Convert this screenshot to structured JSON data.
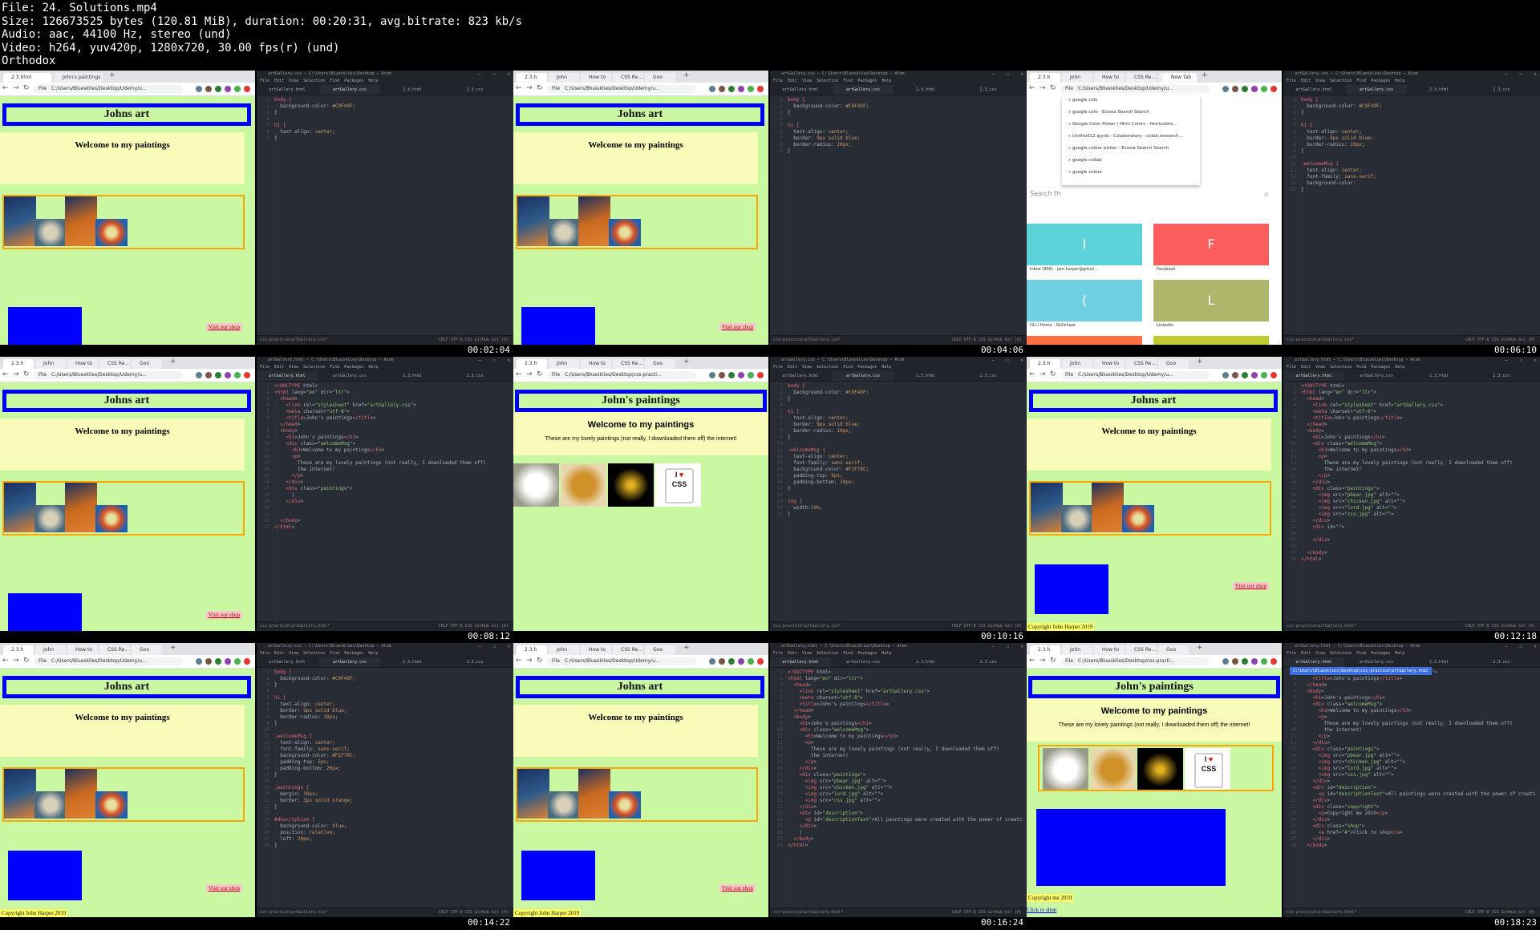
{
  "header": {
    "lines": [
      "File: 24. Solutions.mp4",
      "Size: 126673525 bytes (120.81 MiB), duration: 00:20:31, avg.bitrate: 823 kb/s",
      "Audio: aac, 44100 Hz, stereo (und)",
      "Video: h264, yuv420p, 1280x720, 30.00 fps(r) (und)",
      "Orthodox"
    ]
  },
  "timestamps": [
    "00:02:04",
    "00:04:06",
    "00:06:10",
    "00:08:12",
    "00:10:16",
    "00:12:18",
    "00:14:22",
    "00:16:24",
    "00:18:23"
  ],
  "browser": {
    "url": "C:/Users/Bluesklies/Desktop/Udemy/u...",
    "url2": "C:/Users/Bluesklies/Desktop/css-practi...",
    "url_label": "File",
    "tabs_a": [
      "2.3.html",
      "John's paintings"
    ],
    "tabs_b": [
      "2.3.h",
      "John",
      "How to",
      "CSS Re...",
      "Goo"
    ],
    "site_title_1": "Johns art",
    "site_title_2": "John's paintings",
    "welcome": "Welcome to my paintings",
    "subtitle": "These are my lovely paintings (not really, I downloaded them off) the internet!",
    "shop_link": "Visit our shop",
    "click_shop": "Click to shop",
    "copyright_1": "Copyright John Harper 2019",
    "copyright_2": "Copyright me 2019",
    "description": "All paintings were created with the power of creativity",
    "search_placeholder": "Search th",
    "new_tab": "New Tab",
    "suggestions": [
      "google colo",
      "google colo - Ecosia Search Search",
      "Google Color Picker | Html Colors - htmlcolors...",
      "Untitled12.ipynb - Colaboratory - colab.research...",
      "google colour picker - Ecosia Search Search",
      "google collab",
      "google colors"
    ],
    "tiles": [
      {
        "letter": "I",
        "color": "#5cd3d8",
        "label": "Inbox (996) - jam.harper@gmail..."
      },
      {
        "letter": "F",
        "color": "#fb5d5d",
        "label": "Facebook"
      },
      {
        "letter": "(",
        "color": "#6fd0e3",
        "label": "(9+) Home - Skillshare"
      },
      {
        "letter": "L",
        "color": "#b0b56c",
        "label": "LinkedIn"
      }
    ]
  },
  "atom": {
    "title_css": "artGallery.css — C:\\Users\\Bluesklies\\Desktop — Atom",
    "title_html": "artGallery.html — C:\\Users\\Bluesklies\\Desktop — Atom",
    "menu": "File Edit View Selection Find Packages Help",
    "tabs": [
      "artGallery.html",
      "artGallery.css",
      "2.3.html",
      "2.3.css"
    ],
    "status_css": "css-practice\\artGallery.css*",
    "status_html": "css-practice\\artGallery.html*",
    "status_right": "CRLF  UTF-8  CSS  GitHub  Git (0)",
    "tooltip": "C:\\Users\\Bluesklies\\Desktop\\css-practice\\artGallery.html",
    "css_short": [
      "body {",
      "  background-color: #C9F49F;",
      "}",
      "",
      "h1 {",
      "  text-align: center;",
      "}"
    ],
    "css_border": [
      "body {",
      "  background-color: #C9F49F;",
      "}",
      "",
      "h1 {",
      "  text-align: center;",
      "  border: 9px solid blue;",
      "  border-radius: 10px;",
      "}"
    ],
    "css_welcome": [
      "body {",
      "  background-color: #C9F49F;",
      "}",
      "",
      "h1 {",
      "  text-align: center;",
      "  border: 9px solid blue;",
      "  border-radius: 10px;",
      "}",
      "",
      ".welcomeMsg {",
      "  text-align: center;",
      "  font-family: sans-serif;",
      "  background-color:",
      "}"
    ],
    "css_img": [
      "body {",
      "  background-color: #C9F49F;",
      "}",
      "",
      "h1 {",
      "  text-align: center;",
      "  border: 9px solid blue;",
      "  border-radius: 10px;",
      "}",
      "",
      ".welcomeMsg {",
      "  text-align: center;",
      "  font-family: sans-serif;",
      "  background-color: #F1F78C;",
      "  padding-top: 5px;",
      "  padding-bottom: 20px;",
      "}",
      "",
      "img {",
      "  width:10%;",
      "}"
    ],
    "css_desc": [
      "body {",
      "  background-color: #C9F49F;",
      "}",
      "",
      "h1 {",
      "  text-align: center;",
      "  border: 9px solid blue;",
      "  border-radius: 10px;",
      "}",
      "",
      ".welcomeMsg {",
      "  text-align: center;",
      "  font-family: sans-serif;",
      "  background-color: #F1F78C;",
      "  padding-top: 5px;",
      "  padding-bottom: 20px;",
      "}",
      "",
      ".paintings {",
      "  margin: 30px;",
      "  border: 3px solid orange;",
      "}",
      "",
      "#description {",
      "  background-color: blue;",
      "  position: relative;",
      "  left: 20px;",
      "}"
    ],
    "html_a": [
      "<!DOCTYPE html>",
      "<html lang=\"en\" dir=\"ltr\">",
      "  <head>",
      "    <link rel=\"stylesheet\" href=\"artGallery.css\">",
      "    <meta charset=\"utf-8\">",
      "    <title>John's paintings</title>",
      "  </head>",
      "  <body>",
      "    <h1>John's paintings</h1>",
      "    <div class=\"welcomeMsg\">",
      "      <h3>Welcome to my paintings</h3>",
      "      <p>",
      "        These are my lovely paintings (not really, I downloaded them off)",
      "        the internet!",
      "      </p>",
      "    </div>",
      "    <div class=\"paintings\">",
      "      |",
      "    </div>",
      "",
      "",
      "  </body>",
      "</html>"
    ],
    "html_b": [
      "<!DOCTYPE html>",
      "<html lang=\"en\" dir=\"ltr\">",
      "  <head>",
      "    <link rel=\"stylesheet\" href=\"artGallery.css\">",
      "    <meta charset=\"utf-8\">",
      "    <title>John's paintings</title>",
      "  </head>",
      "  <body>",
      "    <h1>John's paintings</h1>",
      "    <div class=\"welcomeMsg\">",
      "      <h3>Welcome to my paintings</h3>",
      "      <p>",
      "        These are my lovely paintings (not really, I downloaded them off)",
      "        the internet!",
      "      </p>",
      "    </div>",
      "    <div class=\"paintings\">",
      "      <img src=\"pbear.jpg\" alt=\"\">",
      "      <img src=\"chicken.jpg\" alt=\"\">",
      "      <img src=\"lord.jpg\" alt=\"\">",
      "      <img src=\"css.jpg\" alt=\"\">",
      "    </div>",
      "    <div id=\"\">",
      "",
      "    </div>",
      "",
      "  </body>",
      "</html>"
    ],
    "html_c": [
      "<!DOCTYPE html>",
      "<html lang=\"en\" dir=\"ltr\">",
      "  <head>",
      "    <link rel=\"stylesheet\" href=\"artGallery.css\">",
      "    <meta charset=\"utf-8\">",
      "    <title>John's paintings</title>",
      "  </head>",
      "  <body>",
      "    <h1>John's paintings</h1>",
      "    <div class=\"welcomeMsg\">",
      "      <h3>Welcome to my paintings</h3>",
      "      <p>",
      "        These are my lovely paintings (not really, I downloaded them off)",
      "        the internet!",
      "      </p>",
      "    </div>",
      "    <div class=\"paintings\">",
      "      <img src=\"pbear.jpg\" alt=\"\">",
      "      <img src=\"chicken.jpg\" alt=\"\">",
      "      <img src=\"lord.jpg\" alt=\"\">",
      "      <img src=\"css.jpg\" alt=\"\">",
      "    </div>",
      "    <div id=\"description\">",
      "      <p id=\"descriptionText\">All paintings were created with the power of creati",
      "    </div>",
      "    |",
      "  </body>",
      "</html>"
    ],
    "html_d": [
      "  <link rel=\"stylesheet\" href=\"artGallery.css\">",
      "    <title>John's paintings</title>",
      "  </head>",
      "  <body>",
      "    <h1>John's paintings</h1>",
      "    <div class=\"welcomeMsg\">",
      "      <h3>Welcome to my paintings</h3>",
      "      <p>",
      "        These are my lovely paintings (not really, I downloaded them off)",
      "        the internet!",
      "      </p>",
      "    </div>",
      "    <div class=\"paintings\">",
      "      <img src=\"pbear.jpg\" alt=\"\">",
      "      <img src=\"chicken.jpg\" alt=\"\">",
      "      <img src=\"lord.jpg\" alt=\"\">",
      "      <img src=\"css.jpg\" alt=\"\">",
      "    </div>",
      "    <div id=\"description\">",
      "      <p id=\"descriptionText\">All paintings were created with the power of creati",
      "    </div>",
      "    <div class=\"copyright\">",
      "      <p>Copyright me 2019</p>",
      "    </div>",
      "    <div class=\"shop\">",
      "      <a href=\"#\">Click to shop</a>",
      "    </div>",
      "  </body>"
    ]
  }
}
